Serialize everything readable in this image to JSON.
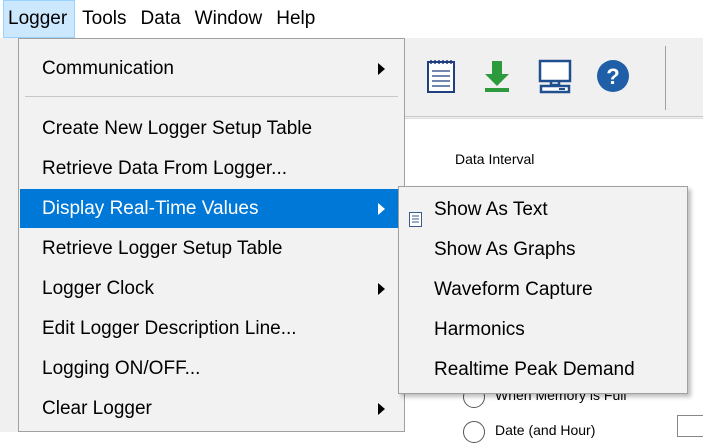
{
  "menubar": {
    "items": [
      "Logger",
      "Tools",
      "Data",
      "Window",
      "Help"
    ]
  },
  "logger_menu": {
    "items": [
      {
        "label": "Communication",
        "submenu": true
      },
      {
        "label": "Create New Logger Setup Table",
        "submenu": false
      },
      {
        "label": "Retrieve Data From Logger...",
        "submenu": false
      },
      {
        "label": "Display Real-Time Values",
        "submenu": true
      },
      {
        "label": "Retrieve Logger Setup Table",
        "submenu": false
      },
      {
        "label": "Logger Clock",
        "submenu": true
      },
      {
        "label": "Edit Logger Description Line...",
        "submenu": false
      },
      {
        "label": "Logging ON/OFF...",
        "submenu": false
      },
      {
        "label": "Clear Logger",
        "submenu": true
      }
    ],
    "highlighted": "Display Real-Time Values"
  },
  "realtime_submenu": {
    "items": [
      "Show As Text",
      "Show As Graphs",
      "Waveform Capture",
      "Harmonics",
      "Realtime Peak Demand"
    ]
  },
  "toolbar": {
    "icons": [
      "notepad-icon",
      "download-icon",
      "computer-icon",
      "help-icon"
    ]
  },
  "panel": {
    "data_interval_label": "Data Interval",
    "radio_1_label": "When Memory is Full",
    "radio_2_label": "Date (and Hour)"
  },
  "colors": {
    "menu_highlight": "#0078d7",
    "menubar_active": "#cce8ff",
    "download_green": "#2e9a3e",
    "help_blue": "#1f5fa8",
    "computer_blue": "#1f4f8f"
  }
}
